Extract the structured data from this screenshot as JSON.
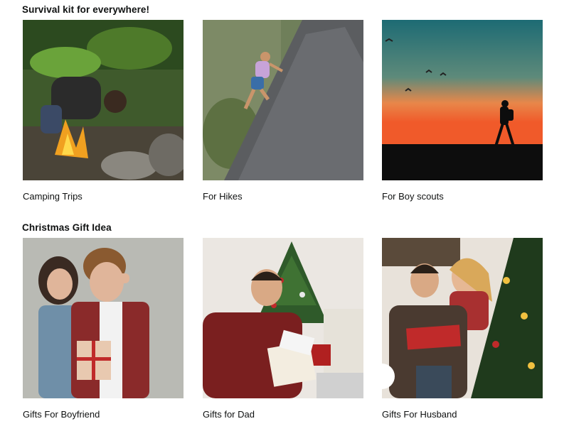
{
  "sections": [
    {
      "title": "Survival kit for everywhere!",
      "tiles": [
        {
          "label": "Camping Trips",
          "image": "man-lighting-campfire-photo"
        },
        {
          "label": "For Hikes",
          "image": "woman-climbing-rock-photo"
        },
        {
          "label": "For Boy scouts",
          "image": "hiker-silhouette-sunset-photo"
        }
      ]
    },
    {
      "title": "Christmas Gift Idea",
      "tiles": [
        {
          "label": "Gifts For Boyfriend",
          "image": "woman-covering-boyfriend-eyes-photo"
        },
        {
          "label": "Gifts for Dad",
          "image": "man-opening-gift-by-tree-photo"
        },
        {
          "label": "Gifts For Husband",
          "image": "wife-surprising-husband-photo"
        }
      ]
    }
  ]
}
